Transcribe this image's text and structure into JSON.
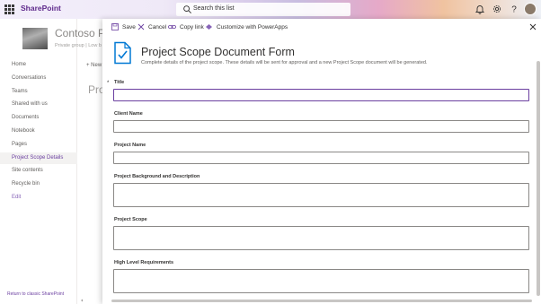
{
  "suitebar": {
    "brand": "SharePoint",
    "search_placeholder": "Search this list",
    "icons": [
      "waffle-icon",
      "search-icon",
      "bell-icon",
      "gear-icon",
      "help-icon"
    ]
  },
  "site": {
    "title": "Contoso Pr",
    "subtitle": "Private group | Low b"
  },
  "leftnav": {
    "items": [
      {
        "label": "Home"
      },
      {
        "label": "Conversations"
      },
      {
        "label": "Teams"
      },
      {
        "label": "Shared with us"
      },
      {
        "label": "Documents"
      },
      {
        "label": "Notebook"
      },
      {
        "label": "Pages"
      },
      {
        "label": "Project Scope Details"
      },
      {
        "label": "Site contents"
      },
      {
        "label": "Recycle bin"
      },
      {
        "label": "Edit"
      }
    ],
    "active": "Project Scope Details",
    "return_link": "Return to classic SharePoint"
  },
  "background_page": {
    "new_label": "New",
    "title_partial": "Pro"
  },
  "form": {
    "commands": {
      "save": "Save",
      "cancel": "Cancel",
      "copy_link": "Copy link",
      "customize": "Customize with PowerApps"
    },
    "title": "Project Scope Document Form",
    "description": "Complete details of the project scope. These details will be sent for approval and a new Project Scope document will be generated.",
    "required_marker": "*",
    "fields": [
      {
        "label": "Title",
        "value": "",
        "required": true,
        "multiline": false
      },
      {
        "label": "Client Name",
        "value": "",
        "required": false,
        "multiline": false
      },
      {
        "label": "Project Name",
        "value": "",
        "required": false,
        "multiline": false
      },
      {
        "label": "Project Background and Description",
        "value": "",
        "required": false,
        "multiline": true
      },
      {
        "label": "Project Scope",
        "value": "",
        "required": false,
        "multiline": true
      },
      {
        "label": "High Level Requirements",
        "value": "",
        "required": false,
        "multiline": true
      }
    ]
  },
  "colors": {
    "accent": "#6b3fa0",
    "brand_text": "#5f2a8c",
    "icon_blue": "#0078d4"
  }
}
